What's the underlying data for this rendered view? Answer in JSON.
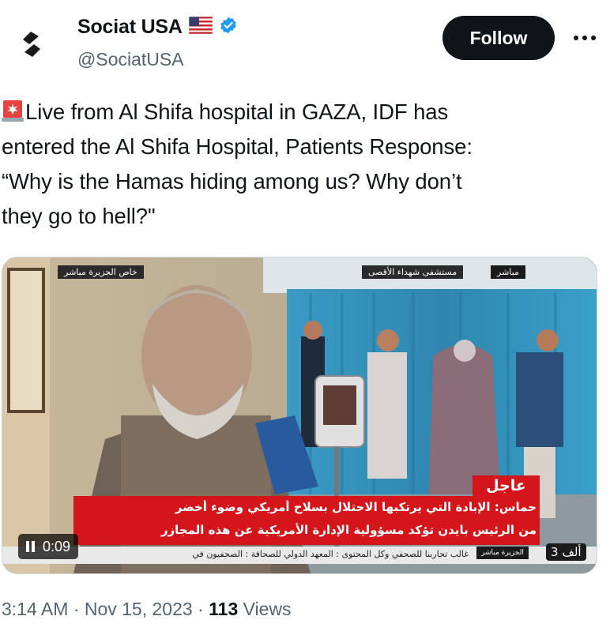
{
  "account": {
    "display_name": "Sociat USA",
    "handle": "@SociatUSA",
    "flag_emoji": "us-flag-icon",
    "verified": true,
    "verified_color": "#1d9bf0"
  },
  "actions": {
    "follow_label": "Follow",
    "more_label": "···"
  },
  "tweet": {
    "lines": [
      "Live from Al Shifa hospital in GAZA, IDF has",
      "entered the Al Shifa Hospital, Patients Response:",
      "“Why is the Hamas hiding among us? Why don’t",
      "they go to hell?\""
    ]
  },
  "video": {
    "time": "0:09",
    "pause_icon": "pause-icon",
    "top_left_badge": "خاص الجزيرة مباشر",
    "top_right_badge": "مستشفى شهداء الأقصى",
    "top_right_tag": "مباشر",
    "breaking_label": "عاجل",
    "headline_line1": "حماس: الإبادة التي يرتكبها الاحتلال بسلاح أمريكي وضوء أخضر",
    "headline_line2": "من الرئيس بايدن تؤكد مسؤولية الإدارة الأمريكية عن هذه المجازر",
    "ticker": "غالب تحاربنا للصحفي وكل المحتوى : المعهد الدولي للصحافة : الصحفيون في",
    "corner_label": "3 ألف",
    "channel_logo": "الجزيرة مباشر"
  },
  "meta": {
    "time": "3:14 AM",
    "separator": "·",
    "date": "Nov 15, 2023",
    "views_count": "113",
    "views_label": "Views"
  },
  "colors": {
    "follow_bg": "#0f1419",
    "secondary_text": "#536471",
    "breaking_red": "#d4161c"
  }
}
